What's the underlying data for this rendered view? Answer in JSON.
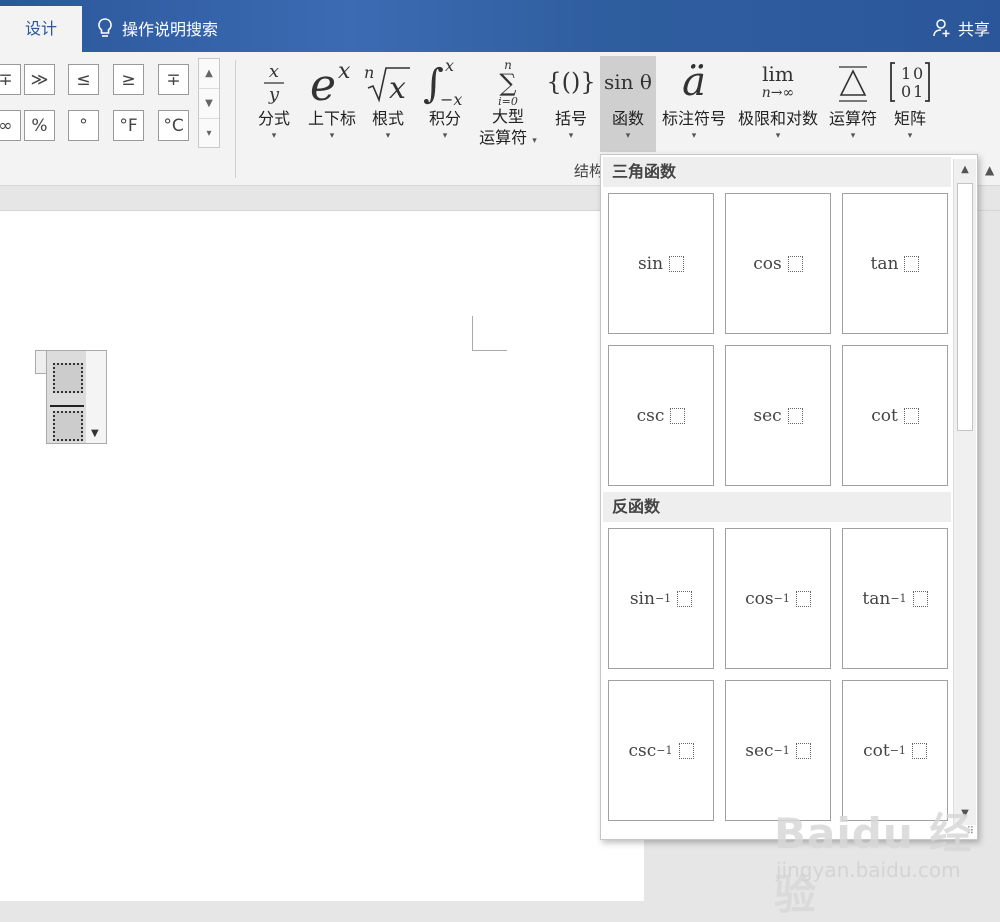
{
  "tabs": {
    "design": "设计",
    "help_search": "操作说明搜索",
    "share": "共享"
  },
  "symbols": {
    "row1": [
      "∓",
      "≫",
      "≤",
      "≥",
      "∓"
    ],
    "row2": [
      "∞",
      "%",
      "°",
      "°F",
      "°C"
    ]
  },
  "tools": [
    {
      "icon": "x/y",
      "label": "分式"
    },
    {
      "icon": "eˣ",
      "label": "上下标"
    },
    {
      "icon": "ⁿ√x",
      "label": "根式"
    },
    {
      "icon": "∫",
      "label": "积分"
    },
    {
      "icon": "∑",
      "label": "大型",
      "label2": "运算符"
    },
    {
      "icon": "{()}",
      "label": "括号"
    },
    {
      "icon": "sin θ",
      "label": "函数"
    },
    {
      "icon": "ä",
      "label": "标注符号"
    },
    {
      "icon": "lim",
      "sub": "n→∞",
      "label": "极限和对数"
    },
    {
      "icon": "Δ",
      "label": "运算符"
    },
    {
      "icon": "[10 01]",
      "label": "矩阵"
    }
  ],
  "group_label": "结构",
  "panel": {
    "trig_title": "三角函数",
    "inverse_title": "反函数",
    "trig": [
      "sin",
      "cos",
      "tan",
      "csc",
      "sec",
      "cot"
    ],
    "inverse": [
      "sin",
      "cos",
      "tan",
      "csc",
      "sec",
      "cot"
    ],
    "inverse_sup": "−1"
  },
  "watermark": {
    "logo": "Baidu 经验",
    "url": "jingyan.baidu.com"
  },
  "colors": {
    "accent": "#2b579a"
  }
}
